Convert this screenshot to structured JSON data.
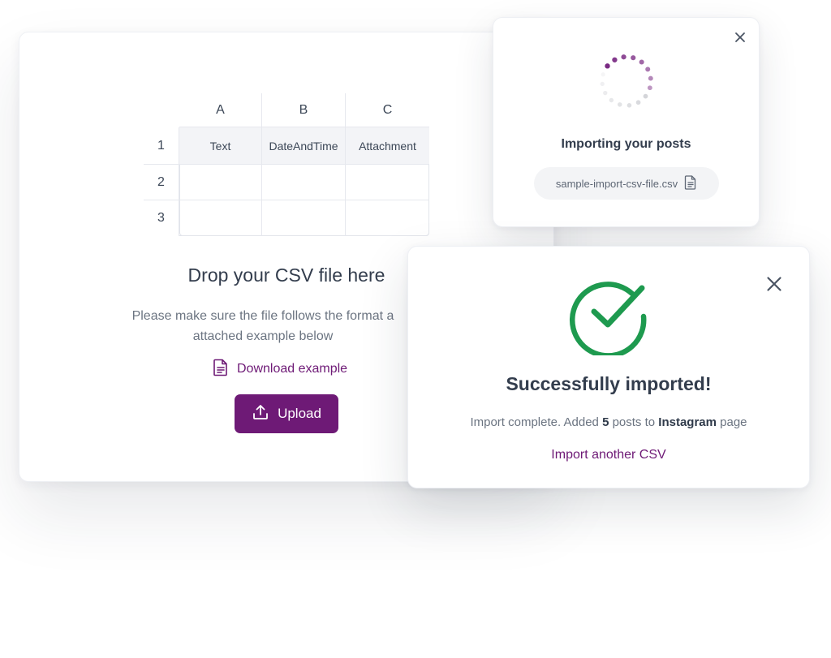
{
  "upload": {
    "spreadsheet": {
      "columns": [
        "A",
        "B",
        "C"
      ],
      "rows": [
        "1",
        "2",
        "3"
      ],
      "header_cells": [
        "Text",
        "DateAndTime",
        "Attachment"
      ]
    },
    "title": "Drop your CSV file here",
    "description": "Please make sure the file follows the format a attached example below",
    "download_label": "Download example",
    "upload_label": "Upload"
  },
  "importing": {
    "title": "Importing your posts",
    "filename": "sample-import-csv-file.csv",
    "close_icon": "close-icon",
    "spinner_color": "#7a2a83"
  },
  "success": {
    "title": "Successfully imported!",
    "message_prefix": "Import complete. Added",
    "count": "5",
    "message_mid": "posts to",
    "platform": "Instagram",
    "message_suffix": "page",
    "link_label": "Import another CSV",
    "check_color": "#1e9a4f"
  },
  "colors": {
    "accent": "#6e1a76",
    "text": "#333d4d",
    "muted": "#6b7481"
  }
}
